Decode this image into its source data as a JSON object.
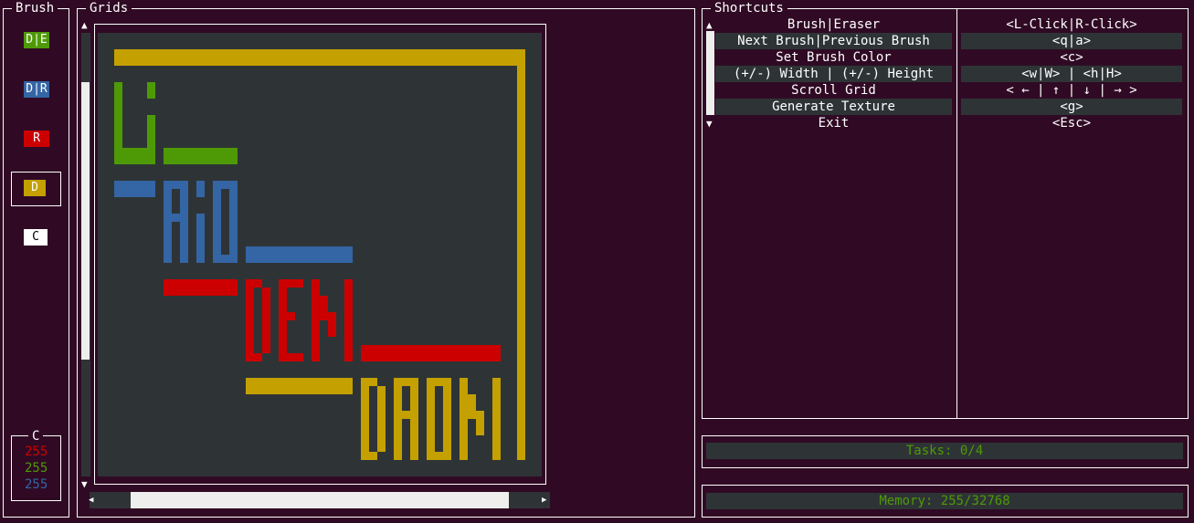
{
  "brush_panel": {
    "title": "Brush",
    "brushes": [
      {
        "label": "D|E",
        "bg": "#4e9a06",
        "fg": "#ffffff"
      },
      {
        "label": "D|R",
        "bg": "#3465a4",
        "fg": "#ffffff"
      },
      {
        "label": "R",
        "bg": "#cc0000",
        "fg": "#ffffff"
      },
      {
        "label": "D",
        "bg": "#c4a000",
        "fg": "#ffffff"
      },
      {
        "label": "C",
        "bg": "#ffffff",
        "fg": "#000000"
      }
    ],
    "selected_index": 3,
    "color_box": {
      "label": "C",
      "r": "255",
      "g": "255",
      "b": "255"
    }
  },
  "grids_panel": {
    "title": "Grids",
    "up_arrow": "▲",
    "down_arrow": "▼",
    "left_arrow": "◀",
    "right_arrow": "▶",
    "canvas_bg": "#2e3436"
  },
  "shortcuts_panel": {
    "title": "Shortcuts",
    "up_arrow": "▲",
    "down_arrow": "▼",
    "rows": [
      {
        "action": "Brush|Eraser",
        "key": "<L-Click|R-Click>"
      },
      {
        "action": "Next Brush|Previous Brush",
        "key": "<q|a>"
      },
      {
        "action": "Set Brush Color",
        "key": "<c>"
      },
      {
        "action": "(+/-) Width | (+/-) Height",
        "key": "<w|W> | <h|H>"
      },
      {
        "action": "Scroll Grid",
        "key": "< ← | ↑ | ↓ | → >"
      },
      {
        "action": "Generate Texture",
        "key": "<g>"
      },
      {
        "action": "Exit",
        "key": "<Esc>"
      }
    ]
  },
  "status": {
    "tasks": "Tasks: 0/4",
    "memory": "Memory: 255/32768"
  },
  "colors": {
    "background": "#300a24",
    "green": "#4e9a06",
    "blue": "#3465a4",
    "red": "#cc0000",
    "yellow": "#c4a000",
    "row_highlight": "#2e3436"
  }
}
